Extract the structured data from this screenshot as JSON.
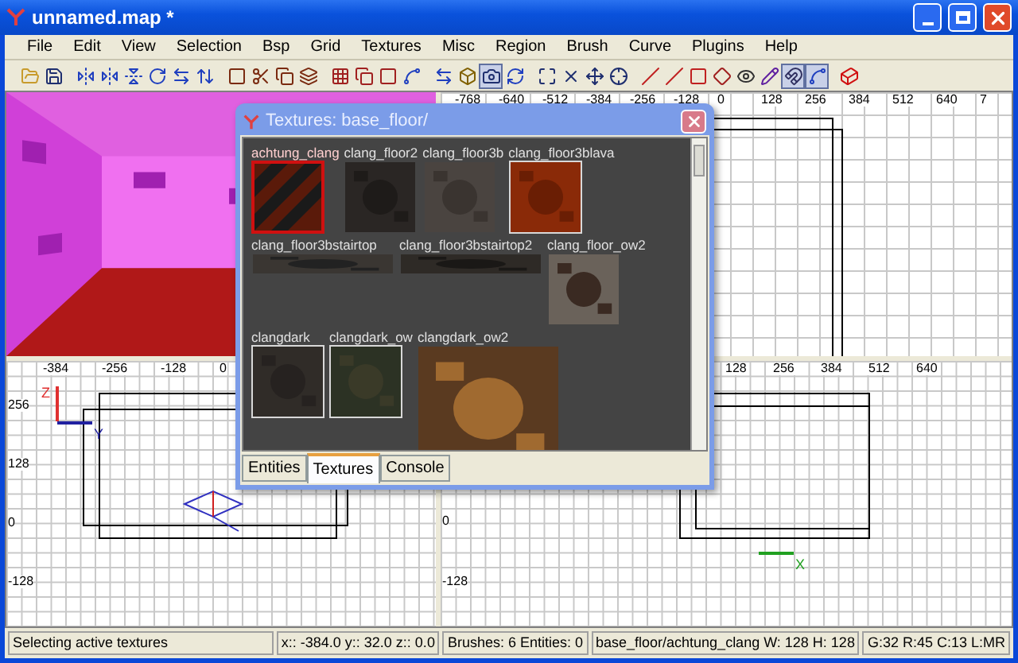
{
  "window": {
    "title": "unnamed.map *"
  },
  "menu": [
    "File",
    "Edit",
    "View",
    "Selection",
    "Bsp",
    "Grid",
    "Textures",
    "Misc",
    "Region",
    "Brush",
    "Curve",
    "Plugins",
    "Help"
  ],
  "toolbar": [
    {
      "pressed": false
    },
    {
      "pressed": false
    },
    {
      "pressed": false
    },
    {
      "pressed": false
    },
    {
      "pressed": false
    },
    {
      "pressed": false
    },
    {
      "pressed": false
    },
    {
      "pressed": false
    },
    {
      "pressed": false
    },
    {
      "pressed": false
    },
    {
      "pressed": false
    },
    {
      "pressed": false
    },
    {
      "pressed": false
    },
    {
      "pressed": false
    },
    {
      "pressed": false
    },
    {
      "pressed": false
    },
    {
      "pressed": false
    },
    {
      "pressed": false
    },
    {
      "pressed": true
    },
    {
      "pressed": false
    },
    {
      "pressed": false
    },
    {
      "pressed": false
    },
    {
      "pressed": false
    },
    {
      "pressed": false
    },
    {
      "pressed": false
    },
    {
      "pressed": false
    },
    {
      "pressed": false
    },
    {
      "pressed": false
    },
    {
      "pressed": false
    },
    {
      "pressed": false
    },
    {
      "pressed": true
    },
    {
      "pressed": true
    },
    {
      "pressed": false
    }
  ],
  "views": [
    {
      "kind": "camera"
    },
    {
      "kind": "grid",
      "top_ruler": [
        "-768",
        "-640",
        "-512",
        "-384",
        "-256",
        "-128",
        "0",
        "128",
        "256",
        "384",
        "512",
        "640",
        "7"
      ]
    },
    {
      "kind": "grid",
      "top_ruler": [
        "-384",
        "-256",
        "-128",
        "0"
      ],
      "side_ruler": [
        "256",
        "128",
        "0",
        "-128"
      ],
      "axis": {
        "vertical": "Z",
        "horizontal": "Y"
      }
    },
    {
      "kind": "grid",
      "top_ruler": [
        "128",
        "256",
        "384",
        "512",
        "640"
      ],
      "side_ruler": [
        "0",
        "-128"
      ],
      "axis": {
        "horizontal": "X"
      }
    }
  ],
  "texture_window": {
    "title": "Textures: base_floor/",
    "textures": [
      {
        "name": "achtung_clang",
        "kind": "square",
        "selected": true,
        "in_use": false
      },
      {
        "name": "clang_floor2",
        "kind": "square",
        "selected": false,
        "in_use": false
      },
      {
        "name": "clang_floor3b",
        "kind": "square",
        "selected": false,
        "in_use": false
      },
      {
        "name": "clang_floor3blava",
        "kind": "square",
        "selected": false,
        "in_use": true
      },
      {
        "name": "clang_floor3bstairtop",
        "kind": "strip",
        "selected": false,
        "in_use": false
      },
      {
        "name": "clang_floor3bstairtop2",
        "kind": "strip",
        "selected": false,
        "in_use": false
      },
      {
        "name": "clang_floor_ow2",
        "kind": "square",
        "selected": false,
        "in_use": false
      },
      {
        "name": "clangdark",
        "kind": "square",
        "selected": false,
        "in_use": true
      },
      {
        "name": "clangdark_ow",
        "kind": "square",
        "selected": false,
        "in_use": true
      },
      {
        "name": "clangdark_ow2",
        "kind": "large",
        "selected": false,
        "in_use": false
      }
    ],
    "tabs": [
      {
        "label": "Entities",
        "selected": false
      },
      {
        "label": "Textures",
        "selected": true
      },
      {
        "label": "Console",
        "selected": false
      }
    ]
  },
  "status_bar": [
    "Selecting active textures",
    "x:: -384.0  y:: 32.0  z:: 0.0",
    "Brushes: 6 Entities: 0",
    "base_floor/achtung_clang W: 128 H: 128",
    "G:32 R:45 C:13 L:MR"
  ]
}
